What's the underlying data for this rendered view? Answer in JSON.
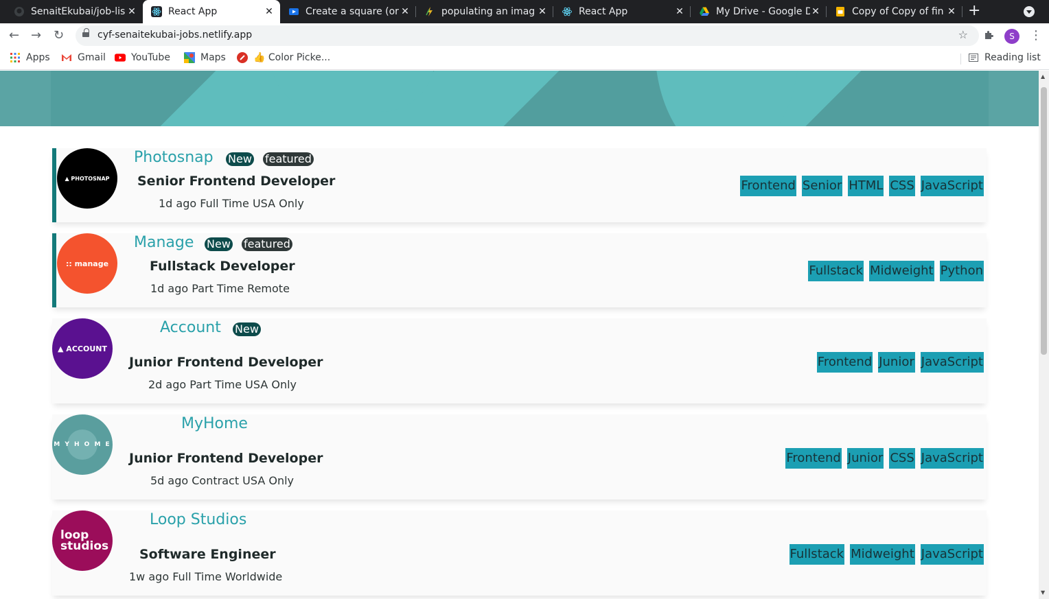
{
  "browser": {
    "tabs": [
      {
        "title": "SenaitEkubai/job-lis",
        "icon": "github-icon"
      },
      {
        "title": "React App",
        "icon": "react-icon"
      },
      {
        "title": "Create a square (or",
        "icon": "video-icon"
      },
      {
        "title": "populating an imag",
        "icon": "link-icon"
      },
      {
        "title": "React App",
        "icon": "react-icon"
      },
      {
        "title": "My Drive - Google D",
        "icon": "drive-icon"
      },
      {
        "title": "Copy of Copy of fin",
        "icon": "slides-icon"
      }
    ],
    "url": "cyf-senaitekubai-jobs.netlify.app",
    "profile_initial": "S",
    "bookmarks": [
      {
        "label": "Apps",
        "icon": "apps-grid-icon"
      },
      {
        "label": "Gmail",
        "icon": "gmail-icon"
      },
      {
        "label": "YouTube",
        "icon": "youtube-icon"
      },
      {
        "label": "Maps",
        "icon": "maps-icon"
      },
      {
        "label": "👍 Color Picke...",
        "icon": "color-picker-icon"
      }
    ],
    "reading_list": "Reading list"
  },
  "jobs": [
    {
      "company": "Photosnap",
      "logo_text": "▲ PHOTOSNAP",
      "logo_color": "#000000",
      "badges": [
        "New",
        "featured"
      ],
      "position": "Senior Frontend Developer",
      "meta": "1d ago Full Time USA Only",
      "tags": [
        "Frontend",
        "Senior",
        "HTML",
        "CSS",
        "JavaScript"
      ]
    },
    {
      "company": "Manage",
      "logo_text": ":: manage",
      "logo_color": "#f4532e",
      "badges": [
        "New",
        "featured"
      ],
      "position": "Fullstack Developer",
      "meta": "1d ago Part Time Remote",
      "tags": [
        "Fullstack",
        "Midweight",
        "Python"
      ]
    },
    {
      "company": "Account",
      "logo_text": "▲ ACCOUNT",
      "logo_color": "#5a1190",
      "badges": [
        "New"
      ],
      "position": "Junior Frontend Developer",
      "meta": "2d ago Part Time USA Only",
      "tags": [
        "Frontend",
        "Junior",
        "JavaScript"
      ]
    },
    {
      "company": "MyHome",
      "logo_text": "M Y H O M E",
      "logo_color": "#5a9e9e",
      "badges": [],
      "position": "Junior Frontend Developer",
      "meta": "5d ago Contract USA Only",
      "tags": [
        "Frontend",
        "Junior",
        "CSS",
        "JavaScript"
      ]
    },
    {
      "company": "Loop Studios",
      "logo_text": "loop studios",
      "logo_color": "#9b0d5a",
      "badges": [],
      "position": "Software Engineer",
      "meta": "1w ago Full Time Worldwide",
      "tags": [
        "Fullstack",
        "Midweight",
        "JavaScript"
      ]
    }
  ]
}
